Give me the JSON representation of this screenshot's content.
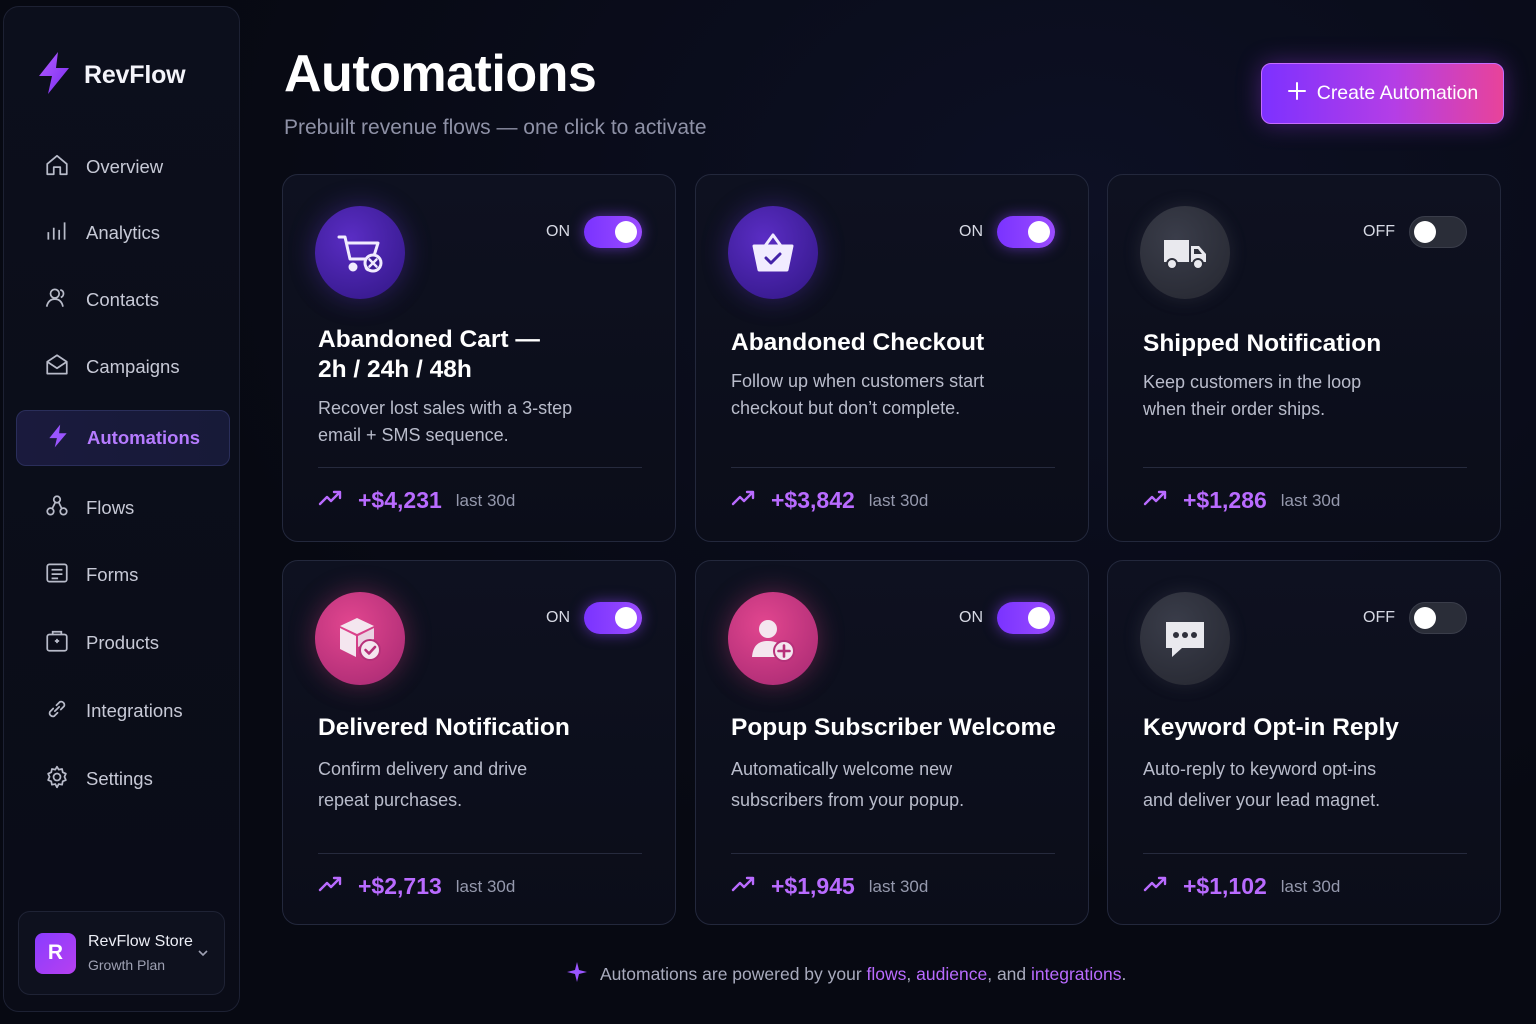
{
  "brand": {
    "name": "RevFlow"
  },
  "nav": [
    {
      "label": "Overview",
      "icon": "home-icon"
    },
    {
      "label": "Analytics",
      "icon": "bar-chart-icon"
    },
    {
      "label": "Contacts",
      "icon": "users-icon"
    },
    {
      "label": "Campaigns",
      "icon": "mail-icon"
    },
    {
      "label": "Automations",
      "icon": "bolt-icon",
      "active": true
    },
    {
      "label": "Flows",
      "icon": "flow-icon"
    },
    {
      "label": "Forms",
      "icon": "form-icon"
    },
    {
      "label": "Products",
      "icon": "package-icon"
    },
    {
      "label": "Integrations",
      "icon": "link-icon"
    },
    {
      "label": "Settings",
      "icon": "gear-icon"
    }
  ],
  "store": {
    "initial": "R",
    "name": "RevFlow Store",
    "plan": "Growth Plan"
  },
  "header": {
    "title": "Automations",
    "subtitle": "Prebuilt revenue flows — one click to activate",
    "create_label": "Create Automation"
  },
  "cards": [
    {
      "title_line1": "Abandoned Cart —",
      "title_line2": "2h / 24h / 48h",
      "desc_line1": "Recover lost sales with a 3-step",
      "desc_line2": "email + SMS sequence.",
      "status": "ON",
      "enabled": true,
      "revenue": "+$4,231",
      "period": "last 30d",
      "icon": "cart-x-icon"
    },
    {
      "title_line1": "Abandoned Checkout",
      "desc_line1": "Follow up when customers start",
      "desc_line2": "checkout but don’t complete.",
      "status": "ON",
      "enabled": true,
      "revenue": "+$3,842",
      "period": "last 30d",
      "icon": "basket-check-icon"
    },
    {
      "title_line1": "Shipped Notification",
      "desc_line1": "Keep customers in the loop",
      "desc_line2": "when their order ships.",
      "status": "OFF",
      "enabled": false,
      "revenue": "+$1,286",
      "period": "last 30d",
      "icon": "truck-icon"
    },
    {
      "title_line1": "Delivered Notification",
      "desc_line1": "Confirm delivery and drive",
      "desc_line2": "repeat purchases.",
      "status": "ON",
      "enabled": true,
      "revenue": "+$2,713",
      "period": "last 30d",
      "icon": "box-check-icon"
    },
    {
      "title_line1": "Popup Subscriber Welcome",
      "desc_line1": "Automatically welcome new",
      "desc_line2": "subscribers from your popup.",
      "status": "ON",
      "enabled": true,
      "revenue": "+$1,945",
      "period": "last 30d",
      "icon": "user-plus-icon"
    },
    {
      "title_line1": "Keyword Opt-in Reply",
      "desc_line1": "Auto-reply to keyword opt-ins",
      "desc_line2": "and deliver your lead magnet.",
      "status": "OFF",
      "enabled": false,
      "revenue": "+$1,102",
      "period": "last 30d",
      "icon": "chat-bubble-icon"
    }
  ],
  "footer": {
    "prefix": "Automations are powered by your",
    "link1": "flows",
    "sep1": ",",
    "link2": "audience",
    "sep2": ", and",
    "link3": "integrations",
    "suffix": "."
  },
  "colors": {
    "accent": "#b96bff",
    "brand_gradient_start": "#7d31ff",
    "brand_gradient_end": "#e8439a"
  }
}
